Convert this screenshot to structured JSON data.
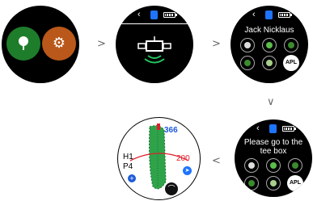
{
  "steps": {
    "home": {
      "icons": [
        "golf-ball-icon",
        "gear-icon"
      ],
      "colors": {
        "left": "#1e7d2a",
        "right": "#b9581a"
      }
    },
    "gps": {
      "icon": "satellite-icon",
      "signal_color": "#22c55e"
    },
    "course": {
      "title": "Jack Nicklaus",
      "icons": [
        "club-icon",
        "course-icon",
        "hole-icon",
        "shot-icon",
        "bluetooth-ab-icon"
      ],
      "apl_label": "APL"
    },
    "tee": {
      "title": "Please go to the tee box",
      "icons": [
        "club-icon",
        "course-icon",
        "hole-icon",
        "shot-icon",
        "bluetooth-ab-icon"
      ],
      "apl_label": "APL"
    },
    "hole": {
      "distance_top": "366",
      "distance_mid": "200",
      "hole_label": "H1",
      "par_label": "P4",
      "colors": {
        "top": "#1e5bd8",
        "mid": "#e11d2b",
        "green": "#2fa34a"
      }
    }
  },
  "arrows": {
    "next": ">",
    "down": "∨",
    "back": "<"
  }
}
